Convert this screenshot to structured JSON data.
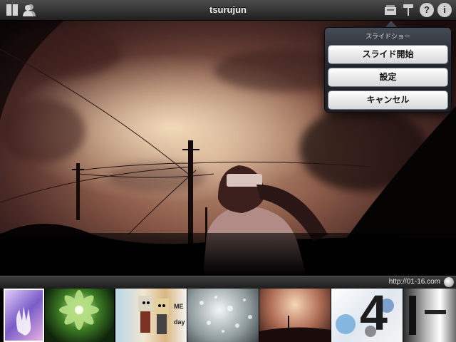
{
  "topbar": {
    "title": "tsurujun",
    "left_icons": [
      "bookmarks-icon",
      "contacts-icon"
    ],
    "right_icons": [
      "slideshow-icon",
      "paint-roller-icon",
      "help-icon",
      "info-icon"
    ],
    "help_glyph": "?",
    "info_glyph": "i"
  },
  "popover": {
    "title": "スライドショー",
    "buttons": [
      {
        "label": "スライド開始"
      },
      {
        "label": "設定"
      },
      {
        "label": "キャンセル"
      }
    ]
  },
  "bottombar": {
    "credit": "http://01-16.com",
    "globe_icon": "globe-icon"
  },
  "thumbnails": {
    "selected_index": 0,
    "count": 9,
    "text_3": "ME",
    "text_3b": "day",
    "text_6": "4"
  },
  "colors": {
    "photo_sky_light": "#c59a7e",
    "photo_sky_dark": "#4a2a26",
    "button_gradient_top": "#ffffff",
    "popover_bg": "#23272e"
  }
}
